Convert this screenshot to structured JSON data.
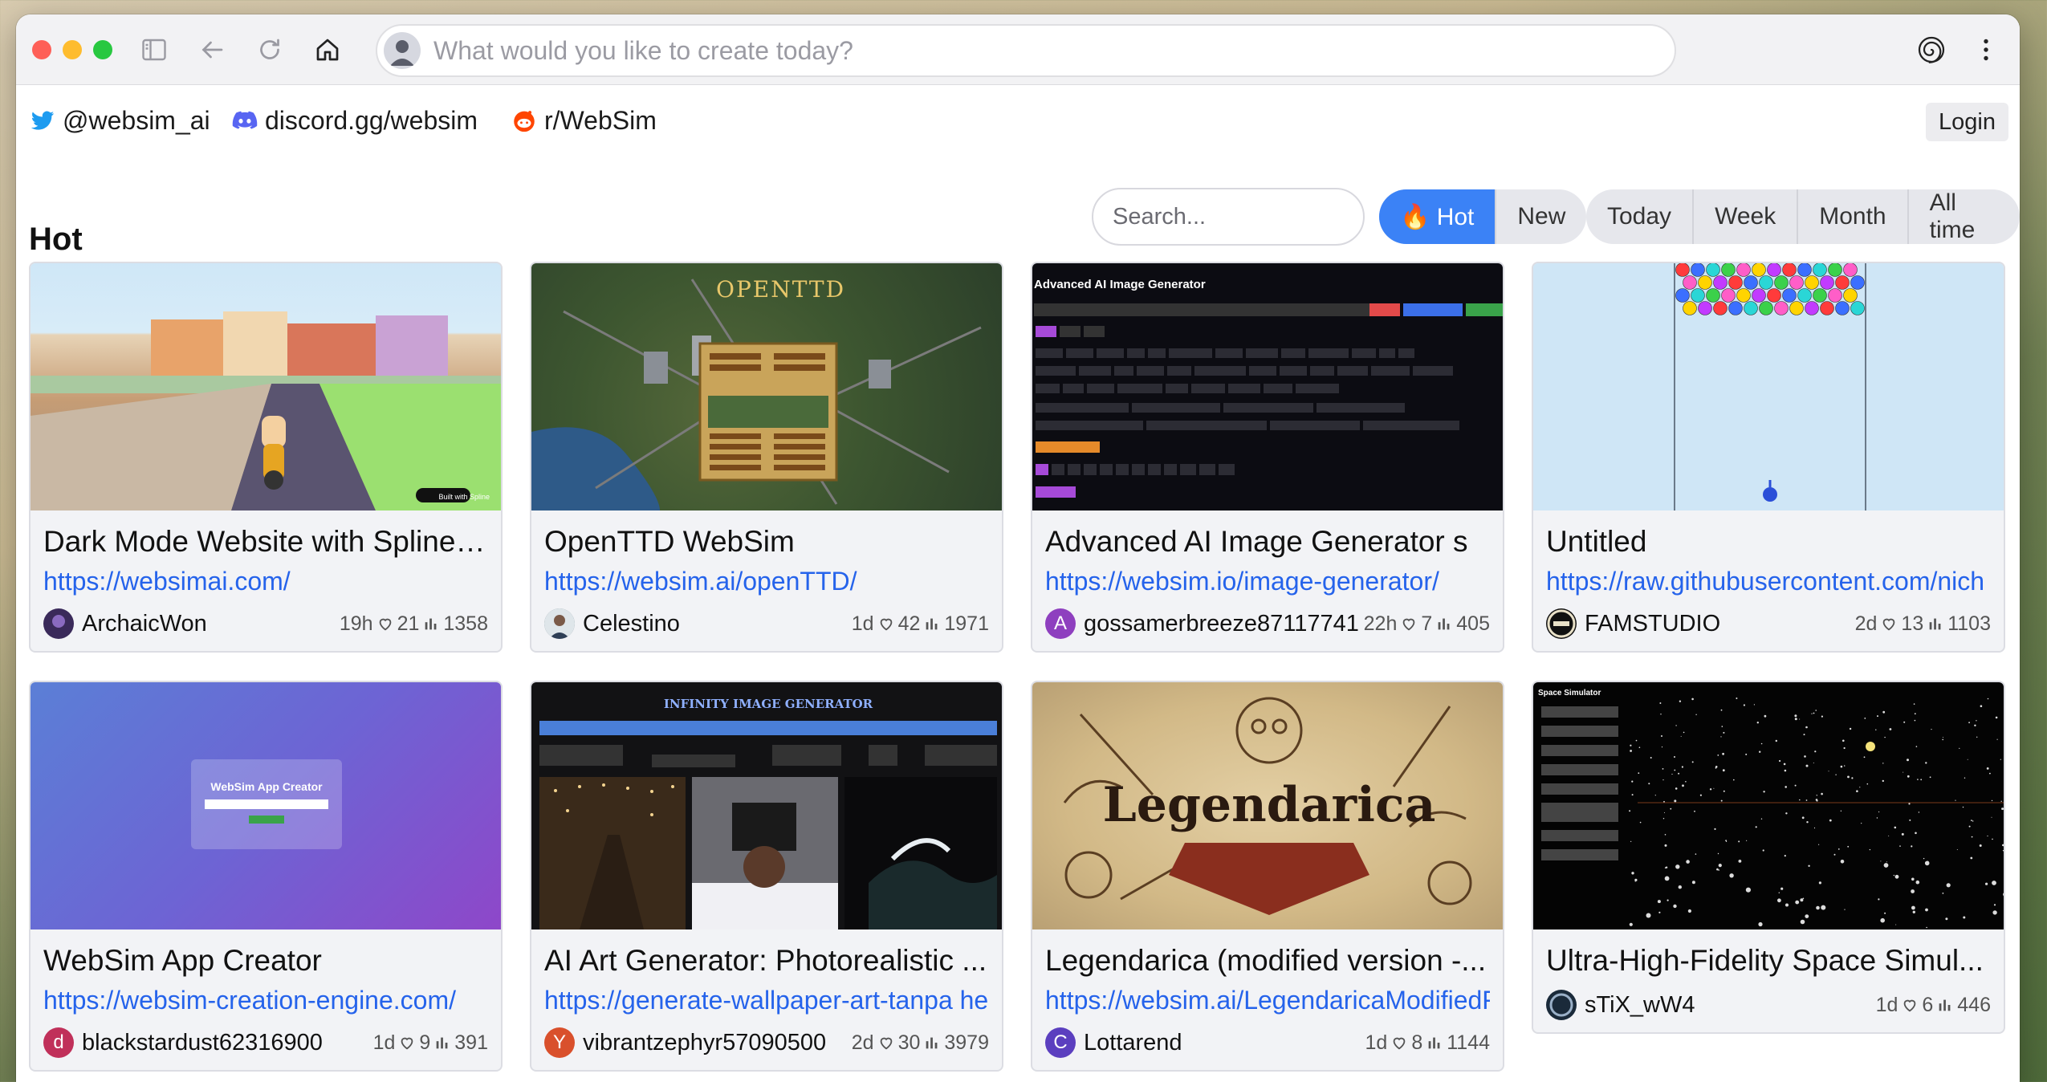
{
  "browser": {
    "address_placeholder": "What would you like to create today?"
  },
  "social": [
    {
      "label": "@websim_ai",
      "icon": "twitter-icon",
      "color": "#1d9bf0"
    },
    {
      "label": "discord.gg/websim",
      "icon": "discord-icon",
      "color": "#5865f2"
    },
    {
      "label": "r/WebSim",
      "icon": "reddit-icon",
      "color": "#ff4500"
    }
  ],
  "login_label": "Login",
  "section_title": "Hot",
  "search_placeholder": "Search...",
  "sort_tabs": [
    {
      "label": "🔥 Hot",
      "active": true
    },
    {
      "label": "New",
      "active": false
    }
  ],
  "time_tabs": [
    {
      "label": "Today"
    },
    {
      "label": "Week"
    },
    {
      "label": "Month"
    },
    {
      "label": "All time"
    }
  ],
  "cards": [
    {
      "title": "Dark Mode Website with Spline ...",
      "url": "https://websimai.com/",
      "user": "ArchaicWon",
      "avatar_letter": "",
      "avatar_color": "#3a2a5a",
      "age": "19h",
      "likes": "21",
      "views": "1358"
    },
    {
      "title": "OpenTTD WebSim",
      "url": "https://websim.ai/openTTD/",
      "user": "Celestino",
      "avatar_letter": "",
      "avatar_color": "#5a6d7a",
      "age": "1d",
      "likes": "42",
      "views": "1971"
    },
    {
      "title": "Advanced AI Image Generator s",
      "url": "https://websim.io/image-generator/",
      "user": "gossamerbreeze87117741",
      "avatar_letter": "A",
      "avatar_color": "#8e3fbf",
      "age": "22h",
      "likes": "7",
      "views": "405"
    },
    {
      "title": "Untitled",
      "url": "https://raw.githubusercontent.com/nich",
      "user": "FAMSTUDIO",
      "avatar_letter": "",
      "avatar_color": "#111111",
      "age": "2d",
      "likes": "13",
      "views": "1103"
    },
    {
      "title": "WebSim App Creator",
      "url": "https://websim-creation-engine.com/",
      "user": "blackstardust62316900",
      "avatar_letter": "d",
      "avatar_color": "#c0305a",
      "age": "1d",
      "likes": "9",
      "views": "391"
    },
    {
      "title": "AI Art Generator: Photorealistic ...",
      "url": "https://generate-wallpaper-art-tanpa he",
      "user": "vibrantzephyr57090500",
      "avatar_letter": "Y",
      "avatar_color": "#d9502c",
      "age": "2d",
      "likes": "30",
      "views": "3979"
    },
    {
      "title": "Legendarica (modified version -...",
      "url": "https://websim.ai/LegendaricaModifiedF",
      "user": "Lottarend",
      "avatar_letter": "C",
      "avatar_color": "#5b3fbf",
      "age": "1d",
      "likes": "8",
      "views": "1144"
    },
    {
      "title": "Ultra-High-Fidelity Space Simul...",
      "url": "",
      "user": "sTiX_wW4",
      "avatar_letter": "",
      "avatar_color": "#1a2a3a",
      "age": "1d",
      "likes": "6",
      "views": "446"
    }
  ],
  "thumb_texts": {
    "ottd_logo": "OPENTTD",
    "ai_title": "Advanced AI Image Generator",
    "inf_title": "INFINITY IMAGE GENERATOR",
    "webapp_title": "WebSim App Creator",
    "legendarica": "Legendarica",
    "space_title": "Space Simulator",
    "spline_badge": "Built with Spline"
  }
}
